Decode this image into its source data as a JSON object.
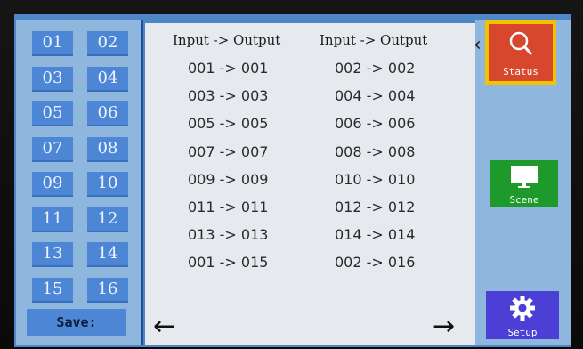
{
  "presets": [
    "01",
    "02",
    "03",
    "04",
    "05",
    "06",
    "07",
    "08",
    "09",
    "10",
    "11",
    "12",
    "13",
    "14",
    "15",
    "16"
  ],
  "save_label": "Save:",
  "headers": [
    "Input -> Output",
    "Input -> Output"
  ],
  "mappings": [
    [
      "001 -> 001",
      "002 -> 002"
    ],
    [
      "003 -> 003",
      "004 -> 004"
    ],
    [
      "005 -> 005",
      "006 -> 006"
    ],
    [
      "007 -> 007",
      "008 -> 008"
    ],
    [
      "009 -> 009",
      "010 -> 010"
    ],
    [
      "011 -> 011",
      "012 -> 012"
    ],
    [
      "013 -> 013",
      "014 -> 014"
    ],
    [
      "001 -> 015",
      "002 -> 016"
    ]
  ],
  "nav": {
    "prev": "←",
    "next": "→",
    "caret": "‹"
  },
  "tiles": {
    "status": {
      "label": "Status",
      "icon": "search-icon",
      "color": "#d6472e",
      "border": "#f0c400"
    },
    "scene": {
      "label": "Scene",
      "icon": "monitor-icon",
      "color": "#1e9a2c"
    },
    "setup": {
      "label": "Setup",
      "icon": "gear-icon",
      "color": "#4b3fd6"
    }
  },
  "colors": {
    "preset": "#4e86d6",
    "panel": "#8fb7de",
    "list_bg": "#e6e9ee"
  }
}
